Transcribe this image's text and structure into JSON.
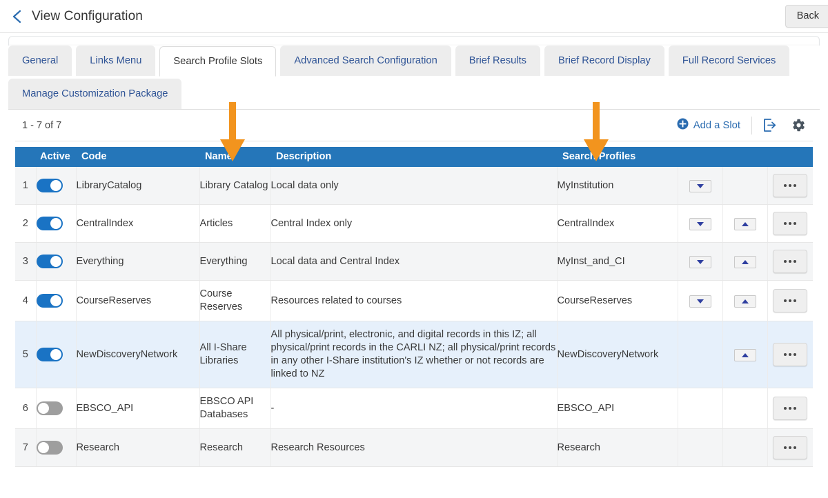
{
  "header": {
    "title": "View Configuration",
    "back_button": "Back",
    "back_chevron_icon": "chevron-left-icon"
  },
  "tabs": {
    "row1": [
      {
        "label": "General",
        "active": false
      },
      {
        "label": "Links Menu",
        "active": false
      },
      {
        "label": "Search Profile Slots",
        "active": true
      },
      {
        "label": "Advanced Search Configuration",
        "active": false
      },
      {
        "label": "Brief Results",
        "active": false
      },
      {
        "label": "Brief Record Display",
        "active": false
      },
      {
        "label": "Full Record Services",
        "active": false
      }
    ],
    "row2": [
      {
        "label": "Manage Customization Package",
        "active": false
      }
    ]
  },
  "toolbar": {
    "count": "1 - 7 of 7",
    "add_slot_label": "Add a Slot",
    "add_slot_icon": "plus-circle-icon",
    "export_icon": "export-icon",
    "settings_icon": "gear-icon"
  },
  "annotations": {
    "arrow_color": "#F2941E",
    "arrows": [
      {
        "name": "arrow-pointing-to-name-column",
        "target": "Name"
      },
      {
        "name": "arrow-pointing-to-search-profiles-column",
        "target": "Search Profiles"
      }
    ]
  },
  "table": {
    "columns": {
      "num": "",
      "active": "Active",
      "code": "Code",
      "name": "Name",
      "description": "Description",
      "profiles": "Search Profiles",
      "move_down": "",
      "move_up": "",
      "actions": ""
    },
    "rows": [
      {
        "num": "1",
        "active": true,
        "code": "LibraryCatalog",
        "name": "Library Catalog",
        "description": "Local data only",
        "profile": "MyInstitution",
        "move_down": true,
        "move_up": false,
        "more": true,
        "highlight": false
      },
      {
        "num": "2",
        "active": true,
        "code": "CentralIndex",
        "name": "Articles",
        "description": "Central Index only",
        "profile": "CentralIndex",
        "move_down": true,
        "move_up": true,
        "more": true,
        "highlight": false
      },
      {
        "num": "3",
        "active": true,
        "code": "Everything",
        "name": "Everything",
        "description": "Local data and Central Index",
        "profile": "MyInst_and_CI",
        "move_down": true,
        "move_up": true,
        "more": true,
        "highlight": false
      },
      {
        "num": "4",
        "active": true,
        "code": "CourseReserves",
        "name": "Course Reserves",
        "description": "Resources related to courses",
        "profile": "CourseReserves",
        "move_down": true,
        "move_up": true,
        "more": true,
        "highlight": false
      },
      {
        "num": "5",
        "active": true,
        "code": "NewDiscoveryNetwork",
        "name": "All I-Share Libraries",
        "description": "All physical/print, electronic, and digital records in this IZ; all physical/print records in the CARLI NZ; all physical/print records in any other I-Share institution's IZ whether or not records are linked to NZ",
        "profile": "NewDiscoveryNetwork",
        "move_down": false,
        "move_up": true,
        "more": true,
        "highlight": true
      },
      {
        "num": "6",
        "active": false,
        "code": "EBSCO_API",
        "name": "EBSCO API Databases",
        "description": "-",
        "profile": "EBSCO_API",
        "move_down": false,
        "move_up": false,
        "more": true,
        "highlight": false
      },
      {
        "num": "7",
        "active": false,
        "code": "Research",
        "name": "Research",
        "description": "Research Resources",
        "profile": "Research",
        "move_down": false,
        "move_up": false,
        "more": true,
        "highlight": false
      }
    ]
  },
  "colors": {
    "header_blue": "#2576b9",
    "link_blue": "#2f5496",
    "toggle_on": "#1a73c4",
    "toggle_off": "#9e9e9e",
    "row_highlight": "#e6f0fb",
    "accent_orange": "#F2941E"
  }
}
